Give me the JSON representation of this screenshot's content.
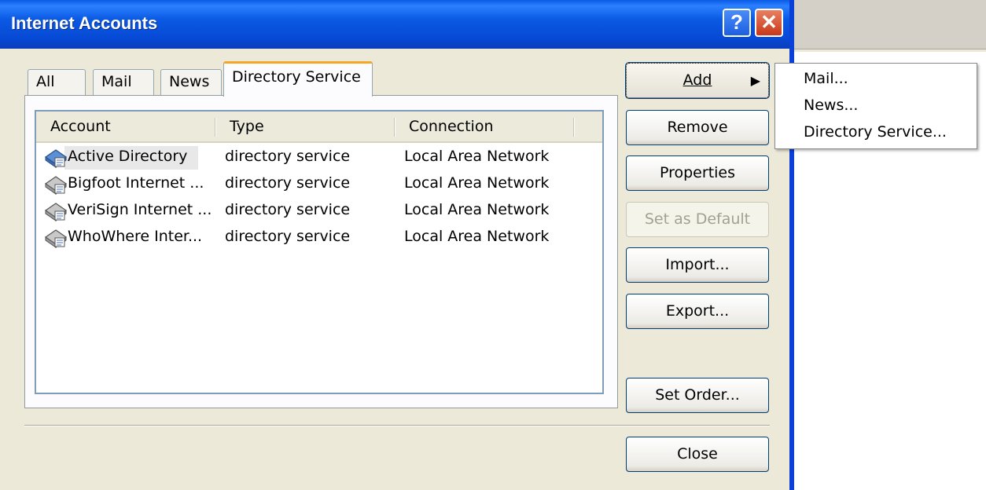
{
  "window": {
    "title": "Internet Accounts",
    "help_glyph": "?",
    "close_glyph": "✕"
  },
  "tabs": [
    {
      "label": "All"
    },
    {
      "label": "Mail"
    },
    {
      "label": "News"
    },
    {
      "label": "Directory Service",
      "active": true
    }
  ],
  "list": {
    "columns": [
      "Account",
      "Type",
      "Connection"
    ],
    "rows": [
      {
        "account": "Active Directory",
        "type": "directory service",
        "connection": "Local Area Network",
        "selected": true
      },
      {
        "account": "Bigfoot Internet ...",
        "type": "directory service",
        "connection": "Local Area Network"
      },
      {
        "account": "VeriSign Internet ...",
        "type": "directory service",
        "connection": "Local Area Network"
      },
      {
        "account": "WhoWhere Inter...",
        "type": "directory service",
        "connection": "Local Area Network"
      }
    ]
  },
  "buttons": {
    "add": "Add",
    "remove": "Remove",
    "properties": "Properties",
    "set_default": "Set as Default",
    "import": "Import...",
    "export": "Export...",
    "set_order": "Set Order...",
    "close": "Close"
  },
  "add_menu": {
    "items": [
      "Mail...",
      "News...",
      "Directory Service..."
    ]
  },
  "icons": {
    "account": "directory-service-icon",
    "submenu": "submenu-arrow-icon"
  },
  "colors": {
    "titlebar": "#0b59e3",
    "dialog_bg": "#ece9d8",
    "active_tab_accent": "#f5a623",
    "close_button": "#c8381a"
  }
}
